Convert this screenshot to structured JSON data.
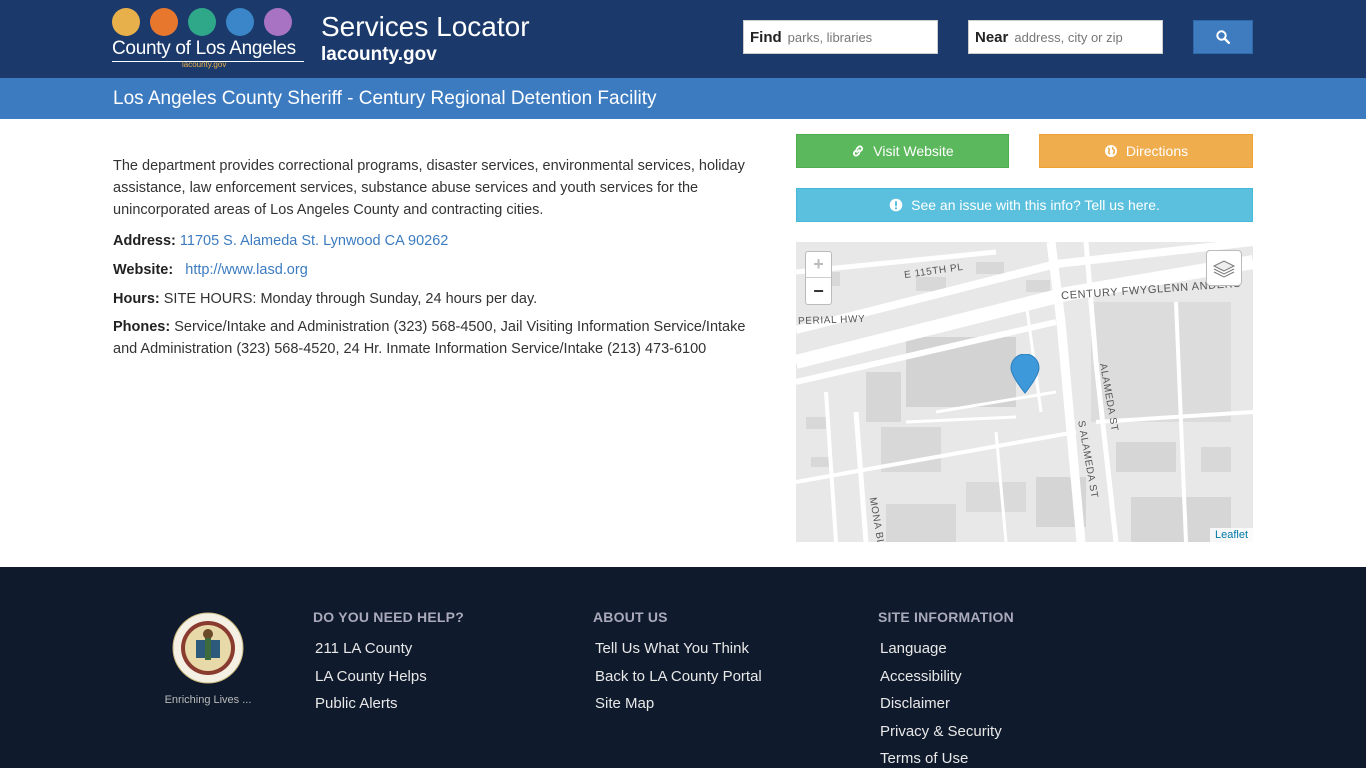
{
  "header": {
    "logo_text": "County of Los Angeles",
    "logo_sub": "lacounty.gov",
    "logo_colors": [
      "#e8b04a",
      "#e8772e",
      "#2fa88a",
      "#3a86c8",
      "#a873c2"
    ],
    "site_title": "Services Locator",
    "site_sub": "lacounty.gov",
    "find_label": "Find",
    "find_placeholder": "parks, libraries",
    "near_label": "Near",
    "near_placeholder": "address, city or zip",
    "search_icon": "search-icon"
  },
  "page_title": "Los Angeles County Sheriff - Century Regional Detention Facility",
  "content": {
    "description": "The department provides correctional programs, disaster services, environmental services, holiday assistance, law enforcement services, substance abuse services and youth services for the unincorporated areas of Los Angeles County and contracting cities.",
    "address_label": "Address:",
    "address_value": "11705 S. Alameda St. Lynwood CA 90262",
    "website_label": "Website:",
    "website_value": "http://www.lasd.org",
    "hours_label": "Hours:",
    "hours_value": "SITE HOURS: Monday through Sunday, 24 hours per day.",
    "phones_label": "Phones:",
    "phones_value": "Service/Intake and Administration (323) 568-4500, Jail Visiting Information Service/Intake and Administration (323) 568-4520, 24 Hr. Inmate Information Service/Intake (213) 473-6100"
  },
  "actions": {
    "visit_website": "Visit Website",
    "directions": "Directions",
    "report_issue": "See an issue with this info? Tell us here."
  },
  "map": {
    "zoom_in": "+",
    "zoom_out": "−",
    "attribution": "Leaflet",
    "labels": {
      "e115": "E 115TH PL",
      "century": "CENTURY FWYGLENN ANDERS",
      "imperial": "PERIAL HWY",
      "alameda1": "ALAMEDA ST",
      "alameda2": "S ALAMEDA ST",
      "mona": "MONA BL"
    }
  },
  "footer": {
    "tagline": "Enriching Lives ...",
    "columns": [
      {
        "heading": "DO YOU NEED HELP?",
        "links": [
          "211 LA County",
          "LA County Helps",
          "Public Alerts"
        ]
      },
      {
        "heading": "ABOUT US",
        "links": [
          "Tell Us What You Think",
          "Back to LA County Portal",
          "Site Map"
        ]
      },
      {
        "heading": "SITE INFORMATION",
        "links": [
          "Language",
          "Accessibility",
          "Disclaimer",
          "Privacy & Security",
          "Terms of Use"
        ]
      }
    ]
  }
}
